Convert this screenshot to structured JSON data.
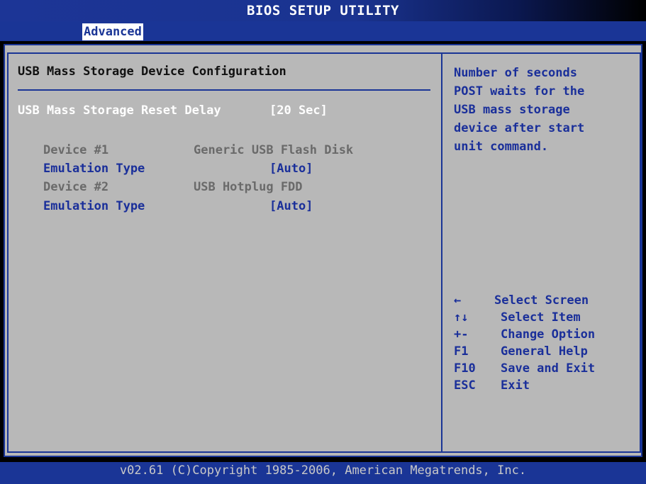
{
  "header": {
    "title": "BIOS SETUP UTILITY",
    "active_tab": "Advanced"
  },
  "main": {
    "section_title": "USB Mass Storage Device Configuration",
    "reset_delay": {
      "label": "USB Mass Storage Reset Delay",
      "value": "[20 Sec]"
    },
    "devices": [
      {
        "label": "Device #1",
        "name": "Generic USB Flash Disk",
        "emulation_label": "Emulation Type",
        "emulation_value": "[Auto]"
      },
      {
        "label": "Device #2",
        "name": "USB Hotplug FDD",
        "emulation_label": "Emulation Type",
        "emulation_value": "[Auto]"
      }
    ]
  },
  "help": {
    "lines": [
      "Number of seconds",
      "POST waits for the",
      "USB mass storage",
      "device after start",
      "unit command."
    ]
  },
  "keys": [
    {
      "key": "←",
      "action": "Select Screen"
    },
    {
      "key": "↑↓",
      "action": "Select Item"
    },
    {
      "key": "+-",
      "action": "Change Option"
    },
    {
      "key": "F1",
      "action": "General Help"
    },
    {
      "key": "F10",
      "action": "Save and Exit"
    },
    {
      "key": "ESC",
      "action": "Exit"
    }
  ],
  "footer": {
    "text": "v02.61 (C)Copyright 1985-2006, American Megatrends, Inc."
  },
  "colors": {
    "bios_blue": "#1a3596",
    "panel_grey": "#b8b8b8",
    "highlight_white": "#ffffff",
    "option_blue": "#1a2f9a",
    "disabled_grey": "#6a6a6a"
  }
}
